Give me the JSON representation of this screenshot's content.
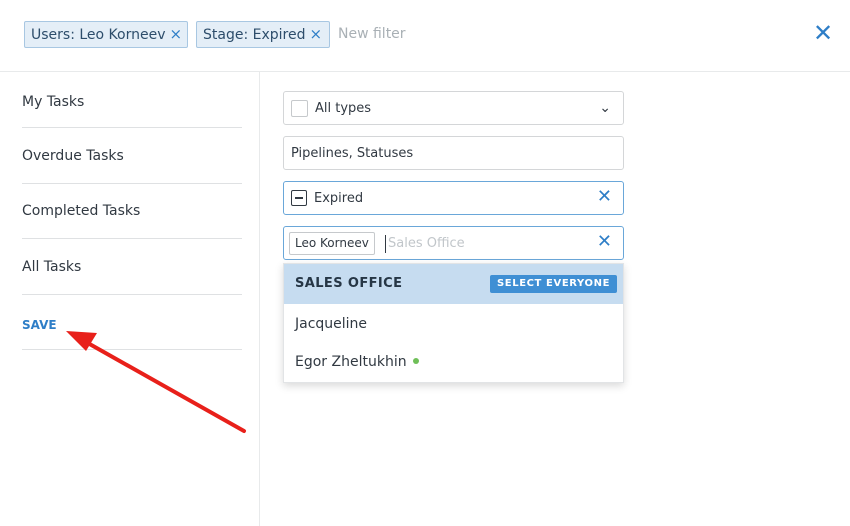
{
  "filters": {
    "chips": [
      {
        "label": "Users: Leo Korneev"
      },
      {
        "label": "Stage: Expired"
      }
    ],
    "chip_remove_glyph": "×",
    "new_filter_placeholder": "New filter",
    "close_glyph": "✕"
  },
  "sidebar": {
    "items": [
      {
        "label": "My Tasks"
      },
      {
        "label": "Overdue Tasks"
      },
      {
        "label": "Completed Tasks"
      },
      {
        "label": "All Tasks"
      }
    ],
    "save_label": "SAVE"
  },
  "form": {
    "types_select": {
      "label": "All types",
      "chevron": "⌄"
    },
    "pipelines_field": {
      "label": "Pipelines, Statuses"
    },
    "stage_field": {
      "label": "Expired",
      "clear_glyph": "✕"
    },
    "users_field": {
      "selected_tag": "Leo Korneev",
      "search_placeholder": "Sales Office",
      "clear_glyph": "✕"
    }
  },
  "dropdown": {
    "group_title": "SALES OFFICE",
    "select_all_label": "SELECT EVERYONE",
    "items": [
      {
        "label": "Jacqueline",
        "online": false
      },
      {
        "label": "Egor Zheltukhin",
        "online": true
      }
    ]
  },
  "colors": {
    "accent": "#2e7ec7",
    "chip_bg": "#e4eef7",
    "dropdown_header_bg": "#c6dcf0",
    "select_all_bg": "#3f8fd4",
    "online_dot": "#6fbf58",
    "annotation_arrow": "#e8201a"
  },
  "icons": {
    "chip_remove": "close-icon",
    "panel_close": "close-icon",
    "select_chevron": "chevron-down-icon",
    "online_status": "status-dot-icon"
  }
}
